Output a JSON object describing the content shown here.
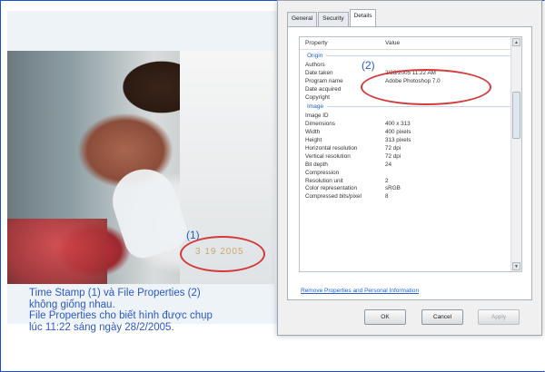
{
  "photo": {
    "stamp_text": "3 19 2005",
    "annotation": "(1)"
  },
  "caption": {
    "lines": [
      "Time Stamp (1) và File Properties (2)",
      "không giống nhau.",
      "File Properties cho biết hình được chụp",
      "lúc 11:22 sáng ngày 28/2/2005."
    ]
  },
  "dialog": {
    "tabs": [
      "General",
      "Security",
      "Details"
    ],
    "active_tab": "Details",
    "columns": {
      "property": "Property",
      "value": "Value"
    },
    "groups": [
      {
        "name": "Origin",
        "rows": [
          {
            "property": "Authors",
            "value": ""
          },
          {
            "property": "Date taken",
            "value": "2/28/2005 11:22 AM"
          },
          {
            "property": "Program name",
            "value": "Adobe Photoshop 7.0"
          },
          {
            "property": "Date acquired",
            "value": ""
          },
          {
            "property": "Copyright",
            "value": ""
          }
        ]
      },
      {
        "name": "Image",
        "rows": [
          {
            "property": "Image ID",
            "value": ""
          },
          {
            "property": "Dimensions",
            "value": "400 x 313"
          },
          {
            "property": "Width",
            "value": "400 pixels"
          },
          {
            "property": "Height",
            "value": "313 pixels"
          },
          {
            "property": "Horizontal resolution",
            "value": "72 dpi"
          },
          {
            "property": "Vertical resolution",
            "value": "72 dpi"
          },
          {
            "property": "Bit depth",
            "value": "24"
          },
          {
            "property": "Compression",
            "value": ""
          },
          {
            "property": "Resolution unit",
            "value": "2"
          },
          {
            "property": "Color representation",
            "value": "sRGB"
          },
          {
            "property": "Compressed bits/pixel",
            "value": "8"
          }
        ]
      }
    ],
    "remove_link": "Remove Properties and Personal Information",
    "buttons": {
      "ok": "OK",
      "cancel": "Cancel",
      "apply": "Apply"
    },
    "annotation": "(2)"
  },
  "colors": {
    "annotation_red": "#d23a3a",
    "caption_blue": "#2a58c8"
  }
}
